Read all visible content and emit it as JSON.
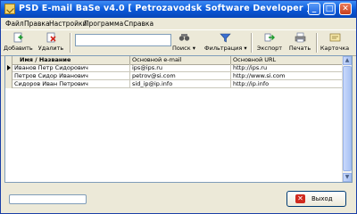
{
  "window": {
    "title": "PSD E-mail BaSe v4.0   [ Petrozavodsk Software Developer ]",
    "minimize_glyph": "_",
    "maximize_glyph": "□",
    "close_glyph": "✕"
  },
  "menu": {
    "items": [
      "Файл",
      "Правка",
      "Настройки",
      "Программа",
      "Справка"
    ]
  },
  "toolbar": {
    "add_label": "Добавить",
    "delete_label": "Удалить",
    "search_value": "",
    "search_label": "Поиск",
    "filter_label": "Фильтрация",
    "export_label": "Экспорт",
    "print_label": "Печать",
    "card_label": "Карточка"
  },
  "table": {
    "columns": [
      "Имя / Название",
      "Основной e-mail",
      "Основной URL"
    ],
    "rows": [
      [
        "Иванов Петр Сидорович",
        "ips@ips.ru",
        "http://ips.ru"
      ],
      [
        "Петров Сидор Иванович",
        "petrov@si.com",
        "http://www.si.com"
      ],
      [
        "Сидоров Иван Петрович",
        "sid_ip@ip.info",
        "http://ip.info"
      ]
    ]
  },
  "footer": {
    "progress": 0,
    "exit_label": "Выход"
  },
  "colors": {
    "title_bar": "#0a57d6",
    "window_bg": "#ece9d8",
    "exit_icon": "#d02a1e"
  }
}
